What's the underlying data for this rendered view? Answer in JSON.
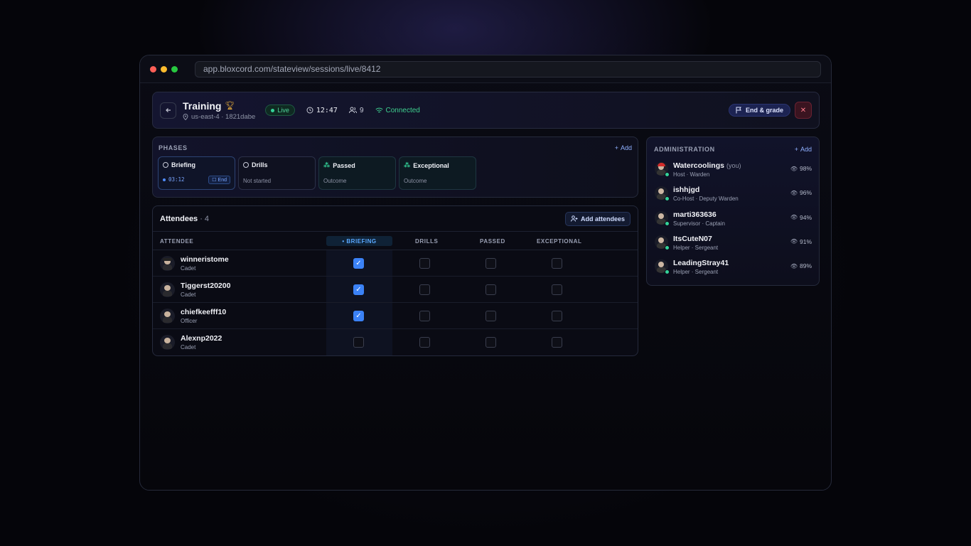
{
  "browser": {
    "url": "app.bloxcord.com/stateview/sessions/live/8412"
  },
  "header": {
    "title": "Training",
    "location": "us-east-4 · 1821dabe",
    "live_label": "Live",
    "timer": "12:47",
    "participant_count": "9",
    "connection_status": "Connected",
    "end_button": "End & grade",
    "close_glyph": "✕"
  },
  "phases": {
    "label": "PHASES",
    "add_label": "Add",
    "items": [
      {
        "name": "Briefing",
        "time": "03:12",
        "end_label": "End",
        "icon": "circle-icon"
      },
      {
        "name": "Drills",
        "status": "Not started",
        "icon": "circle-icon"
      },
      {
        "name": "Passed",
        "status": "Outcome",
        "icon": "sparkle-icon"
      },
      {
        "name": "Exceptional",
        "status": "Outcome",
        "icon": "sparkle-icon"
      }
    ]
  },
  "attendees": {
    "title": "Attendees",
    "count": "· 4",
    "add_button": "Add attendees",
    "columns": [
      "ATTENDEE",
      "• BRIEFING",
      "DRILLS",
      "PASSED",
      "EXCEPTIONAL"
    ],
    "rows": [
      {
        "name": "winneristome",
        "role": "Cadet",
        "briefing": true,
        "drills": false,
        "passed": false,
        "exceptional": false
      },
      {
        "name": "Tiggerst20200",
        "role": "Cadet",
        "briefing": true,
        "drills": false,
        "passed": false,
        "exceptional": false
      },
      {
        "name": "chiefkeefff10",
        "role": "Officer",
        "briefing": true,
        "drills": false,
        "passed": false,
        "exceptional": false
      },
      {
        "name": "Alexnp2022",
        "role": "Cadet",
        "briefing": false,
        "drills": false,
        "passed": false,
        "exceptional": false
      }
    ]
  },
  "administration": {
    "label": "ADMINISTRATION",
    "add_label": "Add",
    "members": [
      {
        "name": "Watercoolings",
        "you": "(you)",
        "role": "Host · Warden",
        "percent": "98%"
      },
      {
        "name": "ishhjgd",
        "you": "",
        "role": "Co-Host · Deputy Warden",
        "percent": "96%"
      },
      {
        "name": "marti363636",
        "you": "",
        "role": "Supervisor · Captain",
        "percent": "94%"
      },
      {
        "name": "ItsCuteN07",
        "you": "",
        "role": "Helper · Sergeant",
        "percent": "91%"
      },
      {
        "name": "LeadingStray41",
        "you": "",
        "role": "Helper · Sergeant",
        "percent": "89%"
      }
    ]
  },
  "colors": {
    "accent": "#3b82f6",
    "live": "#34d399",
    "danger": "#ff7a8a",
    "trophy": "#e3a93a"
  }
}
